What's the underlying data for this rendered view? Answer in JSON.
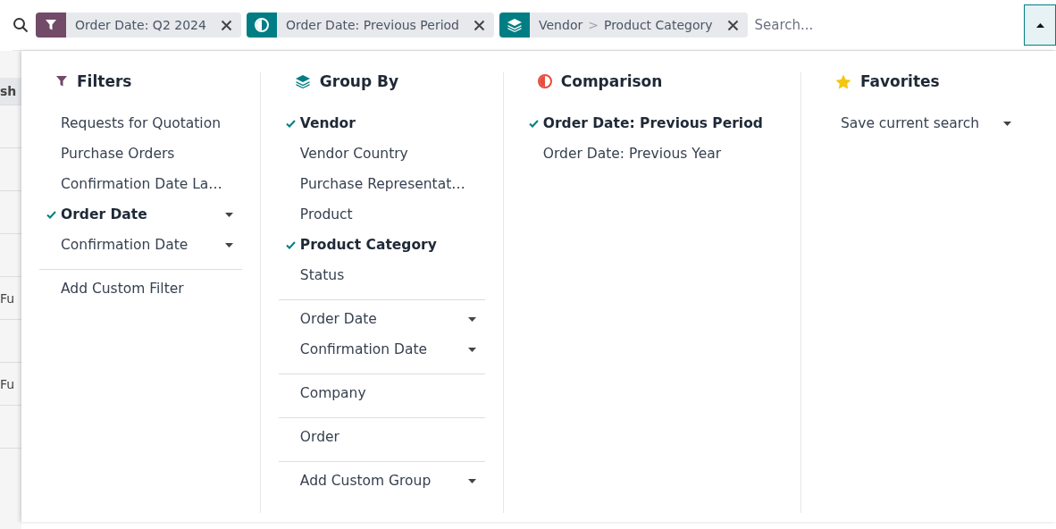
{
  "search_bar": {
    "facets": [
      {
        "kind": "filter",
        "values": [
          "Order Date: Q2 2024"
        ]
      },
      {
        "kind": "comparison",
        "values": [
          "Order Date: Previous Period"
        ]
      },
      {
        "kind": "group",
        "values": [
          "Vendor",
          "Product Category"
        ],
        "separator": ">"
      }
    ],
    "placeholder": "Search..."
  },
  "background_table": {
    "rows": [
      {
        "kind": "header",
        "text": "sh"
      },
      {
        "kind": "blank"
      },
      {
        "kind": "blank"
      },
      {
        "kind": "blank"
      },
      {
        "kind": "blank"
      },
      {
        "kind": "row",
        "text": "Fu"
      },
      {
        "kind": "blank"
      },
      {
        "kind": "row",
        "text": "Fu"
      },
      {
        "kind": "blank"
      }
    ]
  },
  "panel": {
    "columns": [
      {
        "kind": "filters",
        "title": "Filters",
        "groups": [
          [
            {
              "label": "Requests for Quotation",
              "checked": false,
              "has_options": false
            },
            {
              "label": "Purchase Orders",
              "checked": false,
              "has_options": false
            },
            {
              "label": "Confirmation Date La…",
              "checked": false,
              "has_options": false
            },
            {
              "label": "Order Date",
              "checked": true,
              "has_options": true
            },
            {
              "label": "Confirmation Date",
              "checked": false,
              "has_options": true
            }
          ],
          [
            {
              "label": "Add Custom Filter",
              "checked": false,
              "has_options": false
            }
          ]
        ]
      },
      {
        "kind": "group_by",
        "title": "Group By",
        "groups": [
          [
            {
              "label": "Vendor",
              "checked": true,
              "has_options": false
            },
            {
              "label": "Vendor Country",
              "checked": false,
              "has_options": false
            },
            {
              "label": "Purchase Representat…",
              "checked": false,
              "has_options": false
            },
            {
              "label": "Product",
              "checked": false,
              "has_options": false
            },
            {
              "label": "Product Category",
              "checked": true,
              "has_options": false
            },
            {
              "label": "Status",
              "checked": false,
              "has_options": false
            }
          ],
          [
            {
              "label": "Order Date",
              "checked": false,
              "has_options": true
            },
            {
              "label": "Confirmation Date",
              "checked": false,
              "has_options": true
            }
          ],
          [
            {
              "label": "Company",
              "checked": false,
              "has_options": false
            }
          ],
          [
            {
              "label": "Order",
              "checked": false,
              "has_options": false
            }
          ],
          [
            {
              "label": "Add Custom Group",
              "checked": false,
              "has_options": true
            }
          ]
        ]
      },
      {
        "kind": "comparison",
        "title": "Comparison",
        "groups": [
          [
            {
              "label": "Order Date: Previous Period",
              "checked": true,
              "has_options": false
            },
            {
              "label": "Order Date: Previous Year",
              "checked": false,
              "has_options": false
            }
          ]
        ]
      },
      {
        "kind": "favorites",
        "title": "Favorites",
        "groups": [
          [
            {
              "label": "Save current search",
              "checked": false,
              "has_options": true
            }
          ]
        ]
      }
    ]
  }
}
